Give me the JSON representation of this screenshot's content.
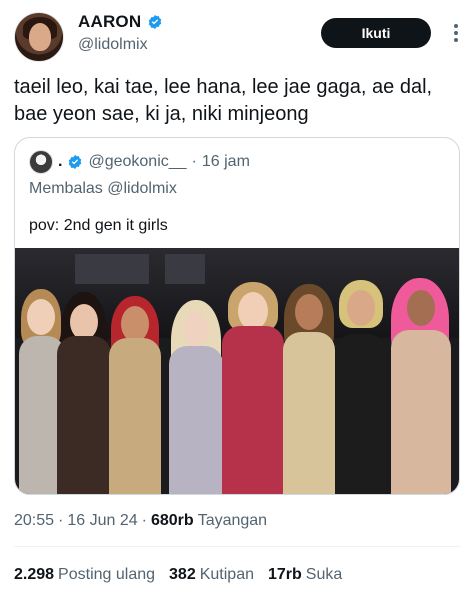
{
  "author": {
    "display_name": "AARON",
    "handle": "@lidolmix"
  },
  "follow_label": "Ikuti",
  "tweet_text": "taeil leo, kai tae, lee hana, lee jae gaga, ae dal, bae yeon sae, ki ja, niki minjeong",
  "quote": {
    "dot": ".",
    "handle": "@geokonic__",
    "separator": "·",
    "time": "16 jam",
    "reply_to": "Membalas @lidolmix",
    "text": "pov: 2nd gen it girls"
  },
  "meta": {
    "time": "20:55",
    "sep1": "·",
    "date": "16 Jun 24",
    "sep2": "·",
    "views": "680rb",
    "views_label": "Tayangan"
  },
  "stats": {
    "reposts": "2.298",
    "reposts_label": "Posting ulang",
    "quotes": "382",
    "quotes_label": "Kutipan",
    "likes": "17rb",
    "likes_label": "Suka"
  },
  "colors": {
    "verified": "#1d9bf0",
    "text_primary": "#0f1419",
    "text_secondary": "#536471",
    "follow_bg": "#0f1419",
    "border": "#cfd9de"
  }
}
